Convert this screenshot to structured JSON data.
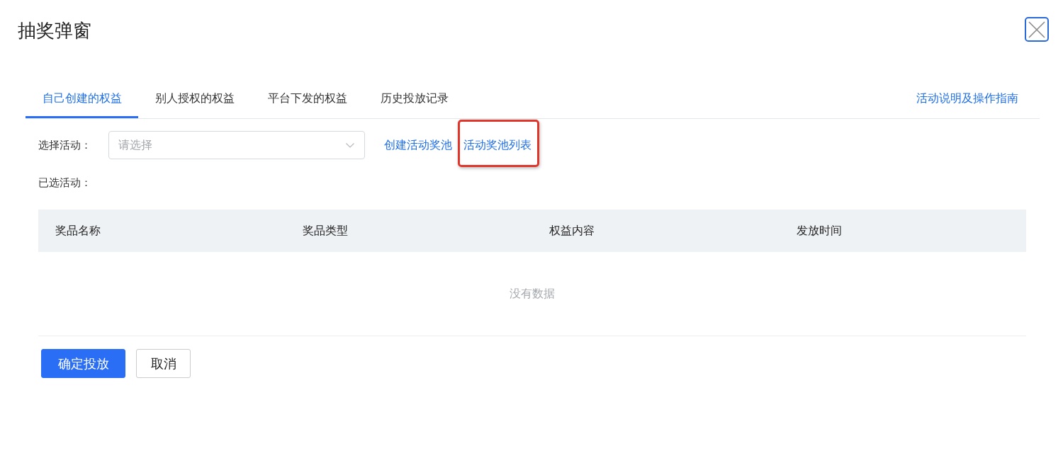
{
  "dialog": {
    "title": "抽奖弹窗"
  },
  "tabs": [
    {
      "label": "自己创建的权益",
      "selected": true
    },
    {
      "label": "别人授权的权益",
      "selected": false
    },
    {
      "label": "平台下发的权益",
      "selected": false
    },
    {
      "label": "历史投放记录",
      "selected": false
    }
  ],
  "help_link": {
    "label": "活动说明及操作指南"
  },
  "activity_select": {
    "label": "选择活动：",
    "placeholder": "请选择"
  },
  "links": [
    {
      "label": "创建活动奖池",
      "highlighted": false
    },
    {
      "label": "活动奖池列表",
      "highlighted": true
    }
  ],
  "selected_activity": {
    "label": "已选活动："
  },
  "table": {
    "columns": [
      "奖品名称",
      "奖品类型",
      "权益内容",
      "发放时间"
    ],
    "empty_text": "没有数据"
  },
  "buttons": [
    {
      "label": "确定投放",
      "kind": "primary"
    },
    {
      "label": "取消",
      "kind": "default"
    }
  ]
}
